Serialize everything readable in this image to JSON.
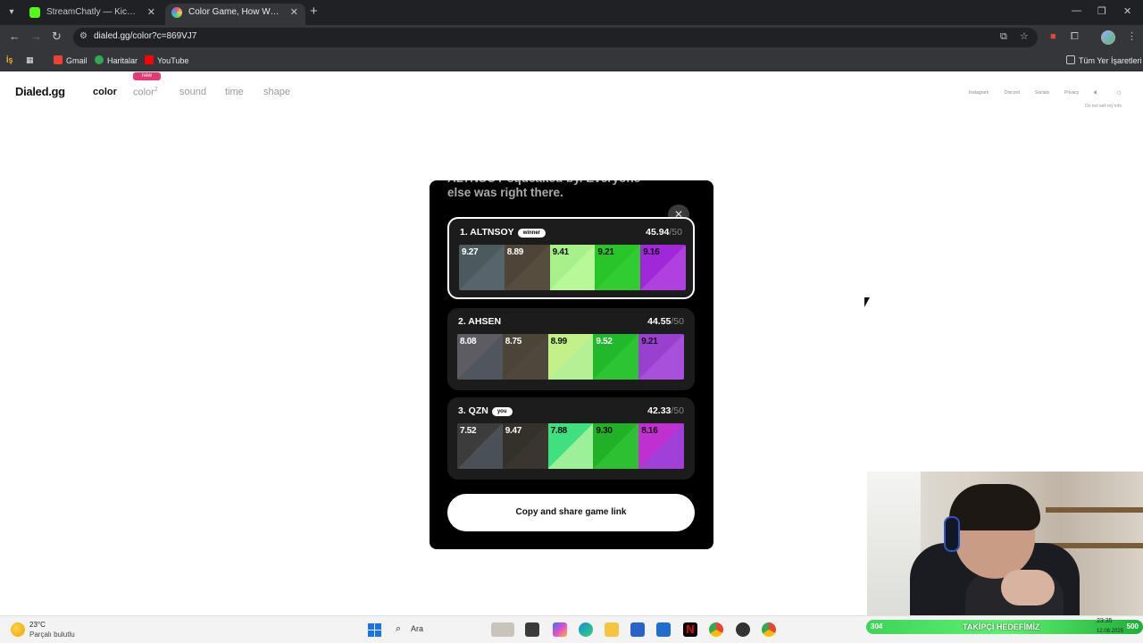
{
  "browser": {
    "tabs": [
      {
        "title": "StreamChatly — Kick Yayıncıları",
        "favicon_color": "#53fc18"
      },
      {
        "title": "Color Game, How Well Can You",
        "favicon_color": "#e94c8a"
      }
    ],
    "new_tab_icon": "plus-icon",
    "url": "dialed.gg/color?c=869VJ7",
    "bookmarks": {
      "apps_label": "İş",
      "gmail": "Gmail",
      "maps": "Haritalar",
      "youtube": "YouTube",
      "all_bookmarks": "Tüm Yer İşaretleri"
    }
  },
  "site": {
    "logo": "Dialed.gg",
    "nav": {
      "color": "color",
      "color2": "color",
      "color2_sup": "2",
      "new_badge": "new",
      "sound": "sound",
      "time": "time",
      "shape": "shape"
    },
    "header_links": {
      "instagram": "Instagram",
      "discord": "Discord",
      "socials": "Socials",
      "privacy": "Privacy",
      "do_not_sell": "Do not sell my info"
    }
  },
  "modal": {
    "message": "ALTNSOY squeaked by. Everyone else was right there.",
    "share_button": "Copy and share game link",
    "players": [
      {
        "rank_name": "1.  ALTNSOY",
        "badge": "winner",
        "score": "45.94",
        "max": "/50",
        "swatches": [
          {
            "value": "9.27",
            "color_a": "#4c5a60",
            "color_b": "#56646b",
            "text": "#ffffff"
          },
          {
            "value": "8.89",
            "color_a": "#4e4538",
            "color_b": "#574d3f",
            "text": "#ffffff"
          },
          {
            "value": "9.41",
            "color_a": "#a8f08a",
            "color_b": "#b8f898",
            "text": "#111111"
          },
          {
            "value": "9.21",
            "color_a": "#28c42a",
            "color_b": "#30cc32",
            "text": "#111111"
          },
          {
            "value": "9.16",
            "color_a": "#a028d8",
            "color_b": "#b040e0",
            "text": "#111111"
          }
        ]
      },
      {
        "rank_name": "2.  AHSEN",
        "badge": "",
        "score": "44.55",
        "max": "/50",
        "swatches": [
          {
            "value": "8.08",
            "color_a": "#5c5c62",
            "color_b": "#50565c",
            "text": "#ffffff"
          },
          {
            "value": "8.75",
            "color_a": "#4a4538",
            "color_b": "#4e483c",
            "text": "#ffffff"
          },
          {
            "value": "8.99",
            "color_a": "#c4f08a",
            "color_b": "#b4f094",
            "text": "#111111"
          },
          {
            "value": "9.52",
            "color_a": "#22b82c",
            "color_b": "#2cc432",
            "text": "#ffffff"
          },
          {
            "value": "9.21",
            "color_a": "#9a40d0",
            "color_b": "#a850dc",
            "text": "#111111"
          }
        ]
      },
      {
        "rank_name": "3.  QZN",
        "badge": "you",
        "score": "42.33",
        "max": "/50",
        "swatches": [
          {
            "value": "7.52",
            "color_a": "#3c3c3c",
            "color_b": "#4a5056",
            "text": "#ffffff"
          },
          {
            "value": "9.47",
            "color_a": "#34302a",
            "color_b": "#3a3530",
            "text": "#ffffff"
          },
          {
            "value": "7.88",
            "color_a": "#40e080",
            "color_b": "#9cf09a",
            "text": "#111111"
          },
          {
            "value": "9.30",
            "color_a": "#22b028",
            "color_b": "#2cc032",
            "text": "#111111"
          },
          {
            "value": "8.16",
            "color_a": "#c030d0",
            "color_b": "#a040d8",
            "text": "#111111"
          }
        ]
      }
    ]
  },
  "taskbar": {
    "temperature": "23°C",
    "weather": "Parçalı bulutlu",
    "search_label": "Ara",
    "goal_current": "304",
    "goal_label": "TAKİPÇİ HEDEFİMİZ",
    "goal_target": "500",
    "time": "23:35",
    "date": "12.08.2025"
  }
}
